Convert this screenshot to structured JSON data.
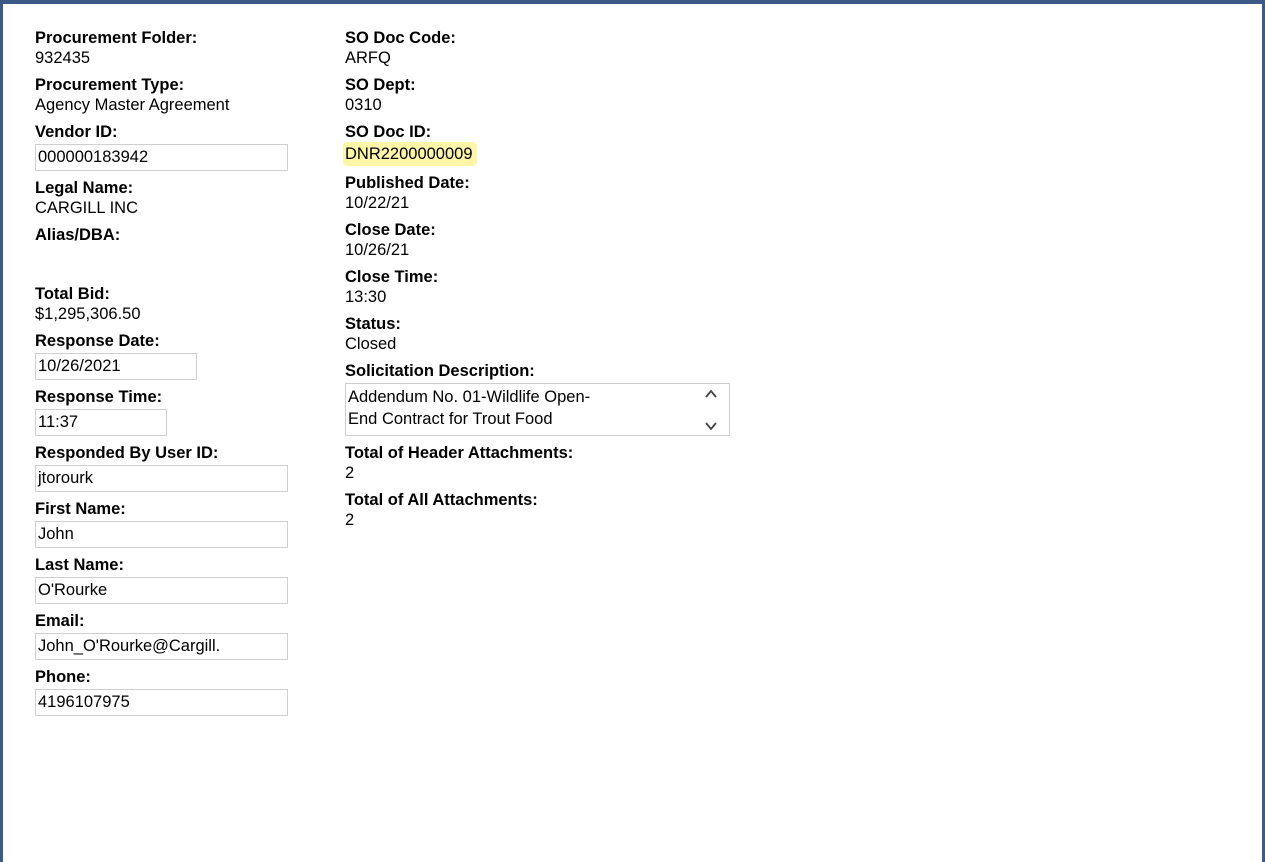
{
  "left": {
    "procurement_folder": {
      "label": "Procurement Folder:",
      "value": "932435"
    },
    "procurement_type": {
      "label": "Procurement Type:",
      "value": "Agency Master Agreement"
    },
    "vendor_id": {
      "label": "Vendor ID:",
      "value": "000000183942"
    },
    "legal_name": {
      "label": "Legal Name:",
      "value": "CARGILL INC"
    },
    "alias": {
      "label": "Alias/DBA:",
      "value": ""
    },
    "total_bid": {
      "label": "Total Bid:",
      "value": "$1,295,306.50"
    },
    "response_date": {
      "label": "Response Date:",
      "value": "10/26/2021"
    },
    "response_time": {
      "label": "Response Time:",
      "value": "11:37"
    },
    "responded_by": {
      "label": "Responded By User ID:",
      "value": "jtorourk"
    },
    "first_name": {
      "label": "First Name:",
      "value": "John"
    },
    "last_name": {
      "label": "Last Name:",
      "value": "O'Rourke"
    },
    "email": {
      "label": "Email:",
      "value": "John_O'Rourke@Cargill."
    },
    "phone": {
      "label": "Phone:",
      "value": "4196107975"
    }
  },
  "right": {
    "so_doc_code": {
      "label": "SO Doc Code:",
      "value": "ARFQ"
    },
    "so_dept": {
      "label": "SO Dept:",
      "value": "0310"
    },
    "so_doc_id": {
      "label": "SO Doc ID:",
      "value": "DNR2200000009"
    },
    "published_date": {
      "label": "Published Date:",
      "value": "10/22/21"
    },
    "close_date": {
      "label": "Close Date:",
      "value": "10/26/21"
    },
    "close_time": {
      "label": "Close Time:",
      "value": "13:30"
    },
    "status": {
      "label": "Status:",
      "value": "Closed"
    },
    "solicitation_description": {
      "label": "Solicitation Description:",
      "line1": "Addendum No. 01-Wildlife Open-",
      "line2": "End Contract for Trout Food"
    },
    "header_attachments": {
      "label": "Total of Header Attachments:",
      "value": "2"
    },
    "all_attachments": {
      "label": "Total of All Attachments:",
      "value": "2"
    }
  },
  "colors": {
    "frame": "#3c5a86",
    "highlight": "#fff7a8",
    "field_border": "#cfcfcf"
  },
  "icons": {
    "scroll_up": "chevron-up-icon",
    "scroll_down": "chevron-down-icon"
  }
}
